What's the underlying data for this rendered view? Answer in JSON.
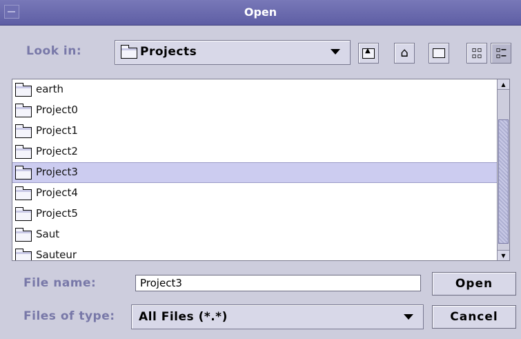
{
  "window": {
    "title": "Open"
  },
  "lookin": {
    "label": "Look in:",
    "value": "Projects"
  },
  "toolbar": {
    "buttons": [
      {
        "name": "up-one-level",
        "icon": "folder-up-icon"
      },
      {
        "name": "home",
        "icon": "home-icon"
      },
      {
        "name": "create-new-folder",
        "icon": "new-folder-icon"
      },
      {
        "name": "list-view",
        "icon": "list-view-icon"
      },
      {
        "name": "details-view",
        "icon": "details-view-icon",
        "active": true
      }
    ]
  },
  "files": {
    "items": [
      {
        "label": "earth"
      },
      {
        "label": "Project0"
      },
      {
        "label": "Project1"
      },
      {
        "label": "Project2"
      },
      {
        "label": "Project3",
        "selected": true
      },
      {
        "label": "Project4"
      },
      {
        "label": "Project5"
      },
      {
        "label": "Saut"
      },
      {
        "label": "Sauteur"
      }
    ]
  },
  "filename": {
    "label": "File name:",
    "value": "Project3"
  },
  "filetype": {
    "label": "Files of type:",
    "value": "All Files (*.*)"
  },
  "buttons": {
    "open": "Open",
    "cancel": "Cancel"
  },
  "colors": {
    "titlebar": "#6464a8",
    "label": "#7878a8",
    "selection": "#ccccf0",
    "background": "#cdcddd"
  }
}
